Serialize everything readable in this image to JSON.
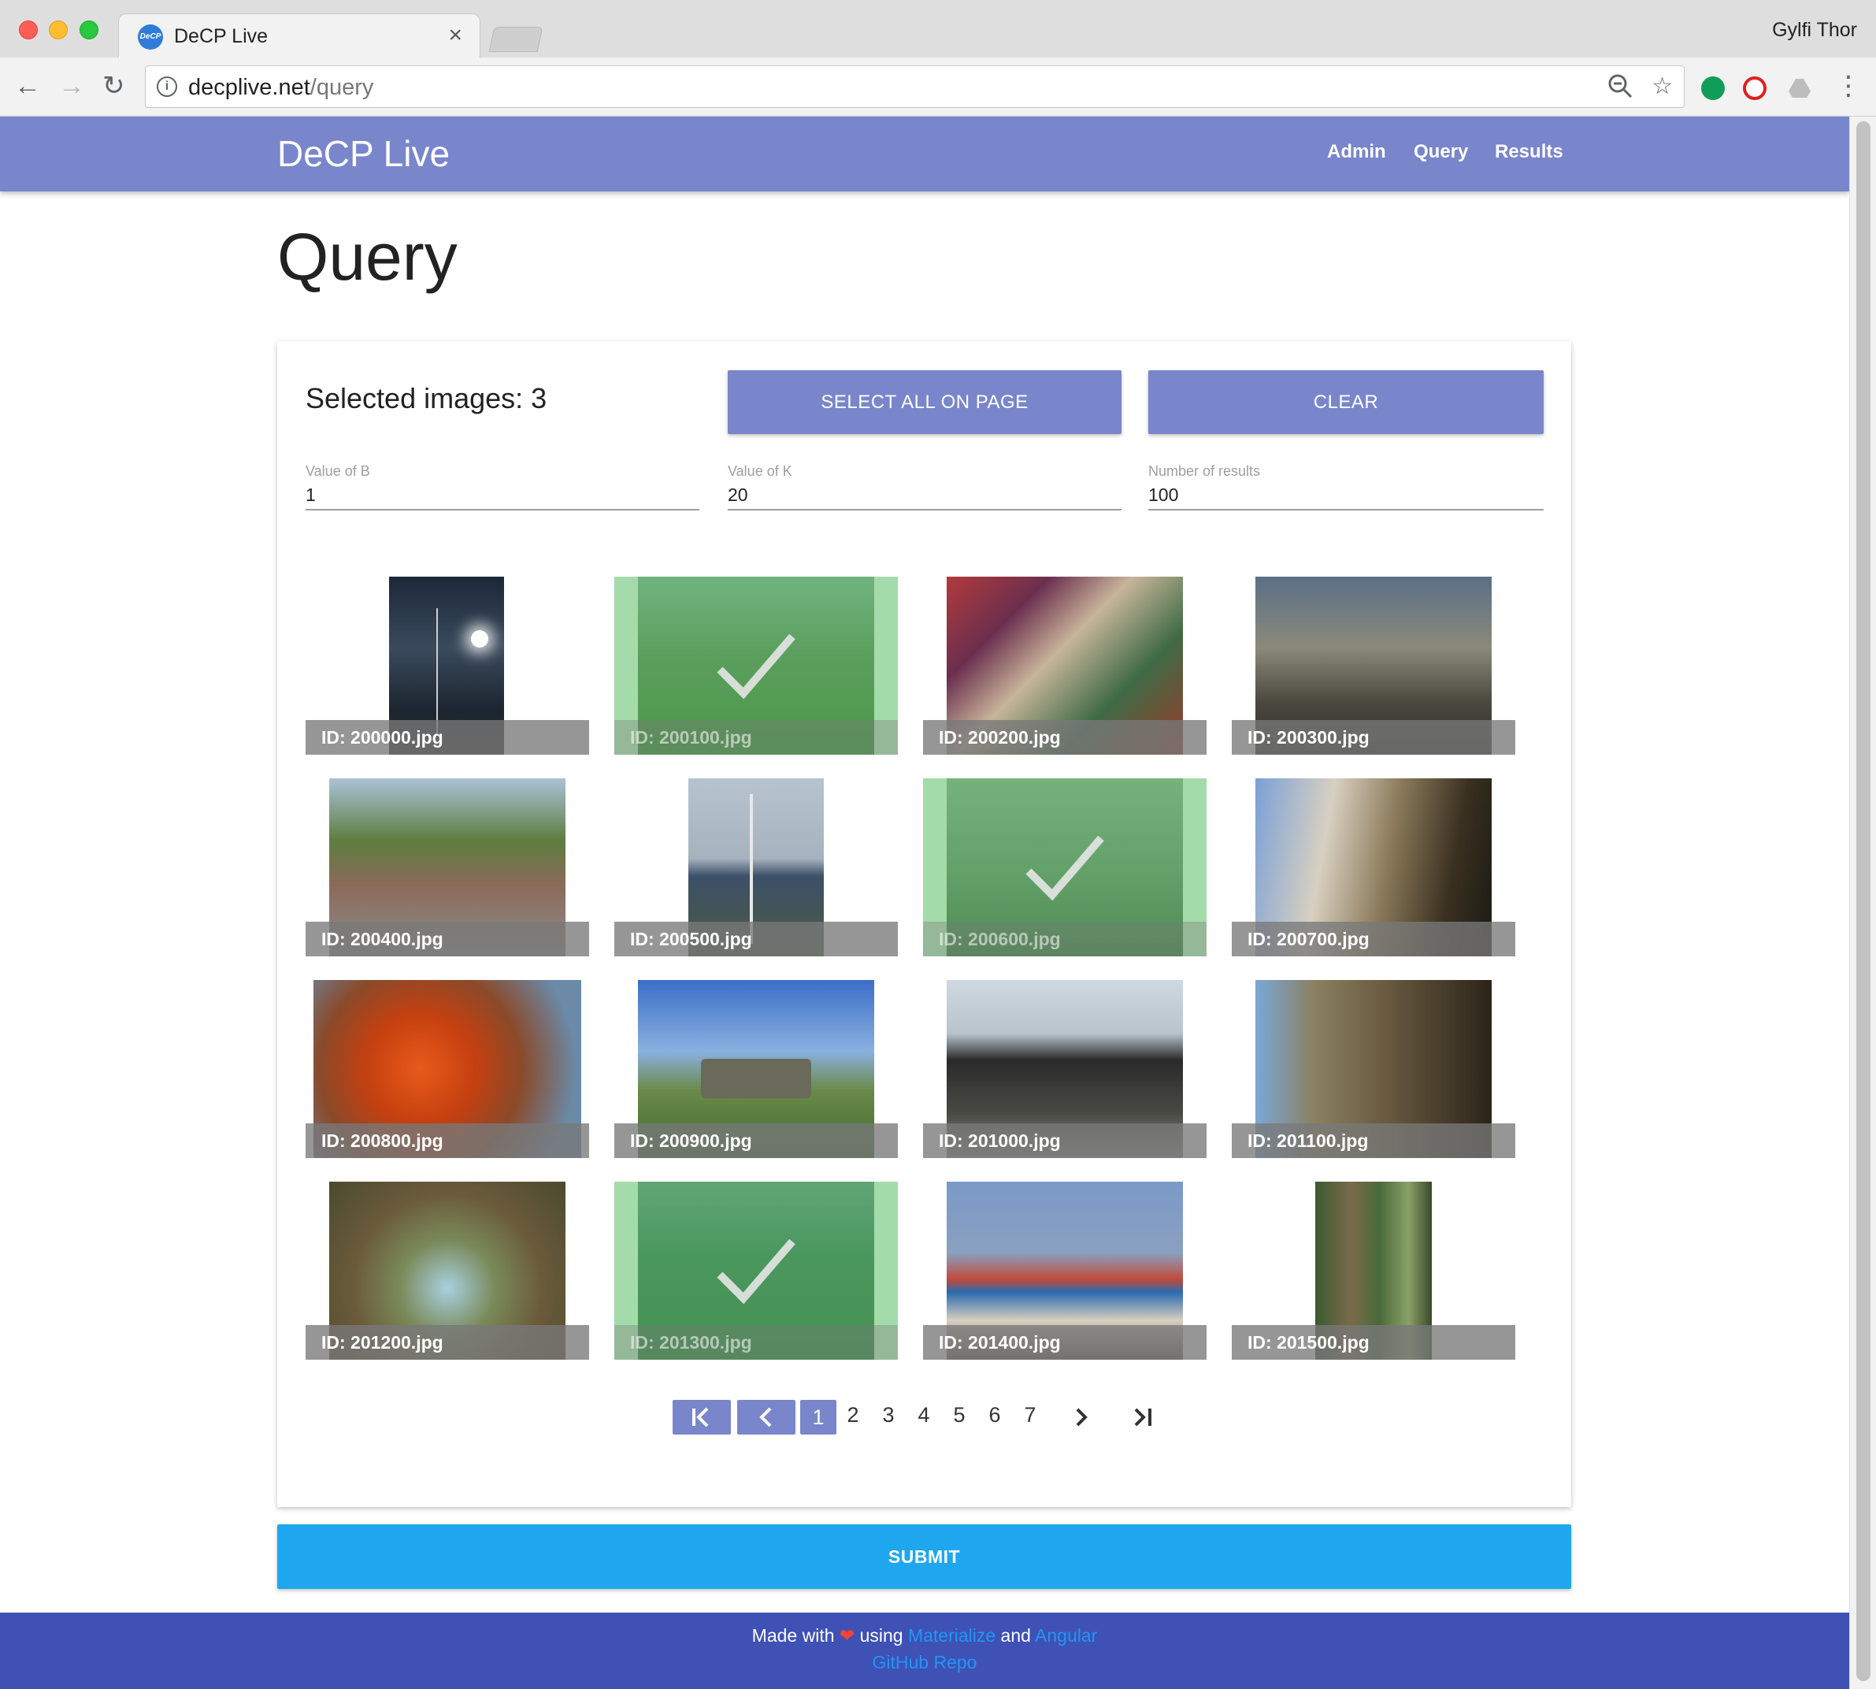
{
  "browser": {
    "tab_title": "DeCP Live",
    "tab_favicon": "DeCP",
    "profile_name": "Gylfi Thor",
    "url_host": "decplive.net",
    "url_path": "/query"
  },
  "navbar": {
    "brand": "DeCP Live",
    "links": [
      "Admin",
      "Query",
      "Results"
    ]
  },
  "page": {
    "title": "Query"
  },
  "selection": {
    "label": "Selected images: 3",
    "select_all_label": "SELECT ALL ON PAGE",
    "clear_label": "CLEAR"
  },
  "fields": [
    {
      "label": "Value of B",
      "value": "1"
    },
    {
      "label": "Value of K",
      "value": "20"
    },
    {
      "label": "Number of results",
      "value": "100"
    }
  ],
  "images": [
    {
      "label": "ID: 200000.jpg",
      "selected": false
    },
    {
      "label": "ID: 200100.jpg",
      "selected": true
    },
    {
      "label": "ID: 200200.jpg",
      "selected": false
    },
    {
      "label": "ID: 200300.jpg",
      "selected": false
    },
    {
      "label": "ID: 200400.jpg",
      "selected": false
    },
    {
      "label": "ID: 200500.jpg",
      "selected": false
    },
    {
      "label": "ID: 200600.jpg",
      "selected": true
    },
    {
      "label": "ID: 200700.jpg",
      "selected": false
    },
    {
      "label": "ID: 200800.jpg",
      "selected": false
    },
    {
      "label": "ID: 200900.jpg",
      "selected": false
    },
    {
      "label": "ID: 201000.jpg",
      "selected": false
    },
    {
      "label": "ID: 201100.jpg",
      "selected": false
    },
    {
      "label": "ID: 201200.jpg",
      "selected": false
    },
    {
      "label": "ID: 201300.jpg",
      "selected": true
    },
    {
      "label": "ID: 201400.jpg",
      "selected": false
    },
    {
      "label": "ID: 201500.jpg",
      "selected": false
    }
  ],
  "pagination": {
    "current": "1",
    "pages": [
      "1",
      "2",
      "3",
      "4",
      "5",
      "6",
      "7"
    ]
  },
  "submit_label": "SUBMIT",
  "footer": {
    "made_with": "Made with",
    "using": "using",
    "materialize": "Materialize",
    "and": "and",
    "angular": "Angular",
    "repo": "GitHub Repo"
  },
  "colors": {
    "navbar": "#7986cb",
    "button": "#7986cb",
    "submit": "#1ea7ef",
    "footer": "#3f51b5",
    "selected_overlay": "#5abe64",
    "link": "#2196f3"
  }
}
